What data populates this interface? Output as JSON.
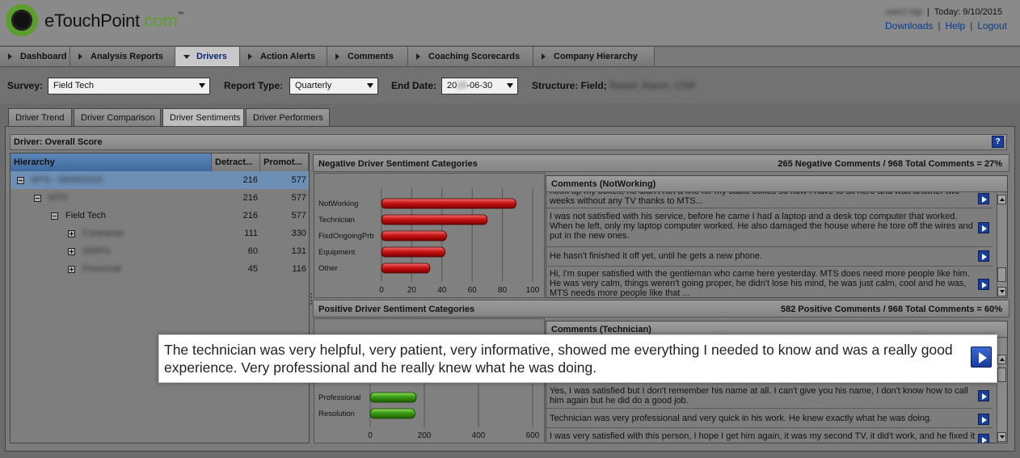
{
  "header": {
    "logo_text": "eTouchPoint",
    "logo_suffix": ".com",
    "logo_tm": "™",
    "user": "user2 etp",
    "today": "Today: 9/10/2015",
    "links": [
      "Downloads",
      "Help",
      "Logout"
    ]
  },
  "nav": {
    "tabs": [
      "Dashboard",
      "Analysis Reports",
      "Drivers",
      "Action Alerts",
      "Comments",
      "Coaching Scorecards",
      "Company Hierarchy"
    ],
    "active": "Drivers"
  },
  "filters": {
    "survey_label": "Survey:",
    "survey_value": "Field Tech",
    "report_type_label": "Report Type:",
    "report_type_value": "Quarterly",
    "end_date_label": "End Date:",
    "end_date_prefix": "20",
    "end_date_hidden": "15",
    "end_date_suffix": "-06-30",
    "structure_label": "Structure: Field;",
    "structure_hidden": "Retail; Alarm; CSR"
  },
  "subtabs": {
    "tabs": [
      "Driver Trend",
      "Driver Comparison",
      "Driver Sentiments",
      "Driver Performers"
    ],
    "active": "Driver Sentiments"
  },
  "driver": {
    "title": "Driver: Overall Score",
    "help": "?"
  },
  "hierarchy": {
    "headers": [
      "Hierarchy",
      "Detract...",
      "Promot..."
    ],
    "rows": [
      {
        "name": "MTS - 09/09/2015",
        "blurred": true,
        "detract": "216",
        "promot": "577",
        "level": 0,
        "exp": "minus",
        "selected": true
      },
      {
        "name": "MTS",
        "blurred": true,
        "detract": "216",
        "promot": "577",
        "level": 1,
        "exp": "minus"
      },
      {
        "name": "Field Tech",
        "blurred": false,
        "detract": "216",
        "promot": "577",
        "level": 2,
        "exp": "minus"
      },
      {
        "name": "Contractor",
        "blurred": true,
        "detract": "111",
        "promot": "330",
        "level": 3,
        "exp": "plus"
      },
      {
        "name": "GWPG",
        "blurred": true,
        "detract": "60",
        "promot": "131",
        "level": 3,
        "exp": "plus"
      },
      {
        "name": "Provincial",
        "blurred": true,
        "detract": "45",
        "promot": "116",
        "level": 3,
        "exp": "plus"
      }
    ]
  },
  "negative": {
    "title": "Negative Driver Sentiment Categories",
    "summary": "265 Negative Comments / 968 Total Comments = 27%",
    "comments_title": "Comments (NotWorking)",
    "comments": [
      {
        "text": "hook up my boxes, he didn't run a line for my cable boxes so now I have to sit here and wait another two weeks without any TV thanks to MTS..."
      },
      {
        "text": "I was not satisfied with his service, before he came I had a laptop and a desk top computer that worked. When he left, only my laptop computer worked. He also damaged the house where he tore off the wires and put in the new ones."
      },
      {
        "text": "He hasn't finished it off yet, until he gets a new phone."
      },
      {
        "text": "Hi, I'm super satisfied with the gentleman who came here yesterday. MTS does need more people like him. He was very calm, things weren't going proper, he didn't lose his mind, he was just calm, cool and he was, MTS needs more people like that ..."
      }
    ]
  },
  "positive": {
    "title": "Positive Driver Sentiment Categories",
    "summary": "582 Positive Comments / 968 Total Comments = 60%",
    "comments_title": "Comments (Technician)",
    "comments": [
      {
        "text": "Yes, I was satisfied but I don't remember his name at all. I can't give you his name, I don't know how to call him again but he did do a good job."
      },
      {
        "text": "Technician was very professional and very quick in his work. He knew exactly what he was doing."
      },
      {
        "text": "I was very satisfied with this person, I hope I get him again, it was my second TV, it did't work, and he fixed it"
      }
    ]
  },
  "popup": {
    "text": "The technician was very helpful, very patient, very informative, showed me everything I needed to know and was a really good experience. Very professional and he really knew what he was doing."
  },
  "chart_data": [
    {
      "type": "bar",
      "orientation": "horizontal",
      "categories": [
        "NotWorking",
        "Technician",
        "FixdOngoingPrb",
        "Equipment",
        "Other"
      ],
      "values": [
        89,
        70,
        43,
        42,
        32
      ],
      "xlim": [
        0,
        100
      ],
      "xticks": [
        0,
        20,
        40,
        60,
        80,
        100
      ],
      "color": "#c81414",
      "grid": true
    },
    {
      "type": "bar",
      "orientation": "horizontal",
      "categories": [
        "Professional",
        "Resolution"
      ],
      "values": [
        170,
        165
      ],
      "xlim": [
        0,
        600
      ],
      "xticks": [
        0,
        200,
        400,
        600
      ],
      "color": "#3a9a14",
      "grid": true
    }
  ]
}
